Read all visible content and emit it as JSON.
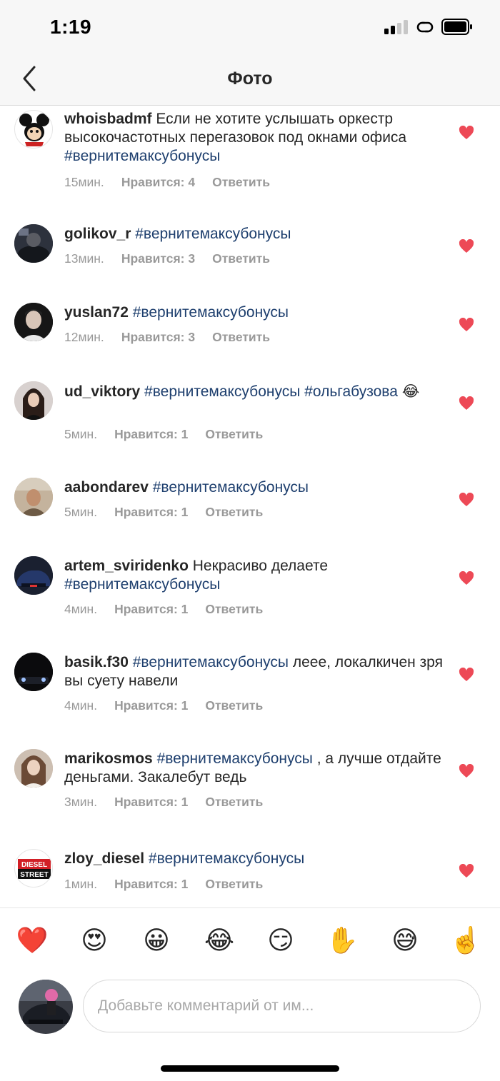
{
  "status_bar": {
    "time": "1:19"
  },
  "nav": {
    "title": "Фото"
  },
  "comments": [
    {
      "username": "whoisbadmf",
      "text_before": "Если не хотите услышать оркестр высокочастотных перегазовок под окнами офиса",
      "tags": "#вернитемаксубонусы",
      "text_after": "",
      "emoji": "",
      "time": "15мин.",
      "likes": "Нравится: 4",
      "reply": "Ответить"
    },
    {
      "username": "golikov_r",
      "text_before": "",
      "tags": "#вернитемаксубонусы",
      "text_after": "",
      "emoji": "",
      "time": "13мин.",
      "likes": "Нравится: 3",
      "reply": "Ответить"
    },
    {
      "username": "yuslan72",
      "text_before": "",
      "tags": "#вернитемаксубонусы",
      "text_after": "",
      "emoji": "",
      "time": "12мин.",
      "likes": "Нравится: 3",
      "reply": "Ответить"
    },
    {
      "username": "ud_viktory",
      "text_before": "",
      "tags": "#вернитемаксубонусы #ольгабузова",
      "text_after": "",
      "emoji": "😂",
      "time": "5мин.",
      "likes": "Нравится: 1",
      "reply": "Ответить"
    },
    {
      "username": "aabondarev",
      "text_before": "",
      "tags": "#вернитемаксубонусы",
      "text_after": "",
      "emoji": "",
      "time": "5мин.",
      "likes": "Нравится: 1",
      "reply": "Ответить"
    },
    {
      "username": "artem_sviridenko",
      "text_before": "Некрасиво делаете",
      "tags": "#вернитемаксубонусы",
      "text_after": "",
      "emoji": "",
      "time": "4мин.",
      "likes": "Нравится: 1",
      "reply": "Ответить"
    },
    {
      "username": "basik.f30",
      "text_before": "",
      "tags": "#вернитемаксубонусы",
      "text_after": "леее, локалкичен зря вы суету навели",
      "emoji": "",
      "time": "4мин.",
      "likes": "Нравится: 1",
      "reply": "Ответить"
    },
    {
      "username": "marikosmos",
      "text_before": "",
      "tags": "#вернитемаксубонусы",
      "text_after": ", а лучше отдайте деньгами. Закалебут ведь",
      "emoji": "",
      "time": "3мин.",
      "likes": "Нравится: 1",
      "reply": "Ответить"
    },
    {
      "username": "zloy_diesel",
      "text_before": "",
      "tags": "#вернитемаксубонусы",
      "text_after": "",
      "emoji": "",
      "time": "1мин.",
      "likes": "Нравится: 1",
      "reply": "Ответить"
    }
  ],
  "avatars": {
    "zloy_diesel_logo_line1": "DIESEL",
    "zloy_diesel_logo_line2": "STREET"
  },
  "emoji_bar": [
    {
      "name": "heart-emoji",
      "glyph": "❤️"
    },
    {
      "name": "heart-eyes-emoji",
      "glyph": "😍"
    },
    {
      "name": "grinning-emoji",
      "glyph": "😀"
    },
    {
      "name": "tears-of-joy-emoji",
      "glyph": "😂"
    },
    {
      "name": "smirk-emoji",
      "glyph": "😏"
    },
    {
      "name": "raised-hand-emoji",
      "glyph": "✋"
    },
    {
      "name": "sweat-smile-emoji",
      "glyph": "😅"
    },
    {
      "name": "point-up-emoji",
      "glyph": "☝️"
    }
  ],
  "comment_input": {
    "placeholder": "Добавьте комментарий от им..."
  },
  "colors": {
    "heart": "#ed4956",
    "hashtag": "#1e3f6e",
    "meta": "#999999"
  }
}
